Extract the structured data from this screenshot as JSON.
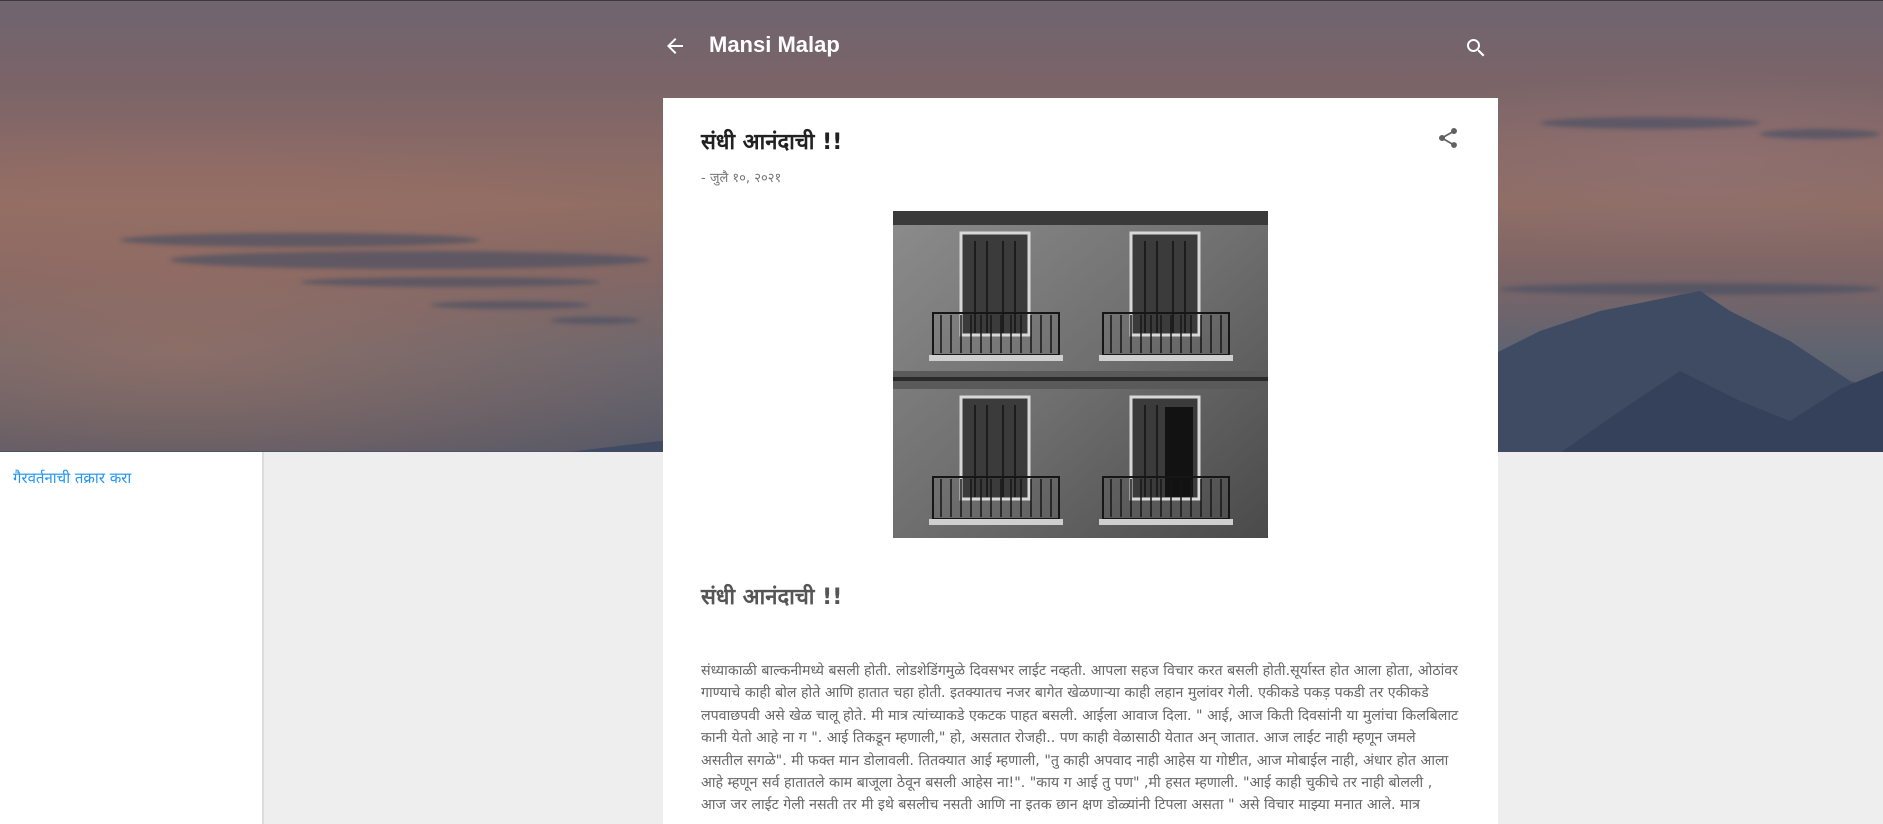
{
  "header": {
    "blog_title": "Mansi Malap",
    "back_icon": "arrow-left-icon",
    "search_icon": "search-icon"
  },
  "sidebar": {
    "report_abuse_label": "गैरवर्तनाची तक्रार करा"
  },
  "post": {
    "title": "संधी आनंदाची !!",
    "date": "- जुलै १०, २०२१",
    "share_icon": "share-icon",
    "image_icon": "building-balconies-photo",
    "subheading": "संधी आनंदाची !!",
    "body": "संध्याकाळी बाल्कनीमध्ये बसली होती. लोडशेडिंगमुळे दिवसभर लाईट नव्हती. आपला सहज विचार करत बसली होती.सूर्यास्त होत आला होता, ओठांवर गाण्याचे काही बोल होते आणि हातात चहा होती. इतक्यातच नजर बागेत खेळणाऱ्या काही लहान मुलांवर गेली. एकीकडे पकड़ पकडी तर एकीकडे लपवाछपवी असे खेळ चालू होते. मी मात्र त्यांच्याकडे एकटक पाहत बसली. आईला आवाज दिला. \" आई, आज किती दिवसांनी या मुलांचा किलबिलाट कानी येतो आहे ना ग \". आई तिकडून म्हणाली,\" हो, असतात रोजही.. पण काही वेळासाठी येतात अन् जातात. आज लाईट नाही म्हणून जमले असतील सगळे\". मी फक्त मान डोलावली. तितक्यात आई म्हणाली, \"तु काही अपवाद नाही आहेस या गोष्टीत, आज मोबाईल नाही, अंधार होत आला आहे म्हणून सर्व हातातले काम बाजूला ठेवून बसली आहेस ना!\". \"काय ग आई तु पण\" ,मी हसत म्हणाली. \"आई काही चुकीचे तर नाही बोलली , आज जर लाईट गेली नसती तर मी इथे बसलीच नसती आणि ना इतक छान क्षण डोळ्यांनी टिपला असता \" असे विचार माझ्या मनात आले. मात्र"
  },
  "colors": {
    "link": "#2196f3",
    "title_text": "#ffffff",
    "card_bg": "#ffffff",
    "page_bg": "#eeeeee"
  }
}
